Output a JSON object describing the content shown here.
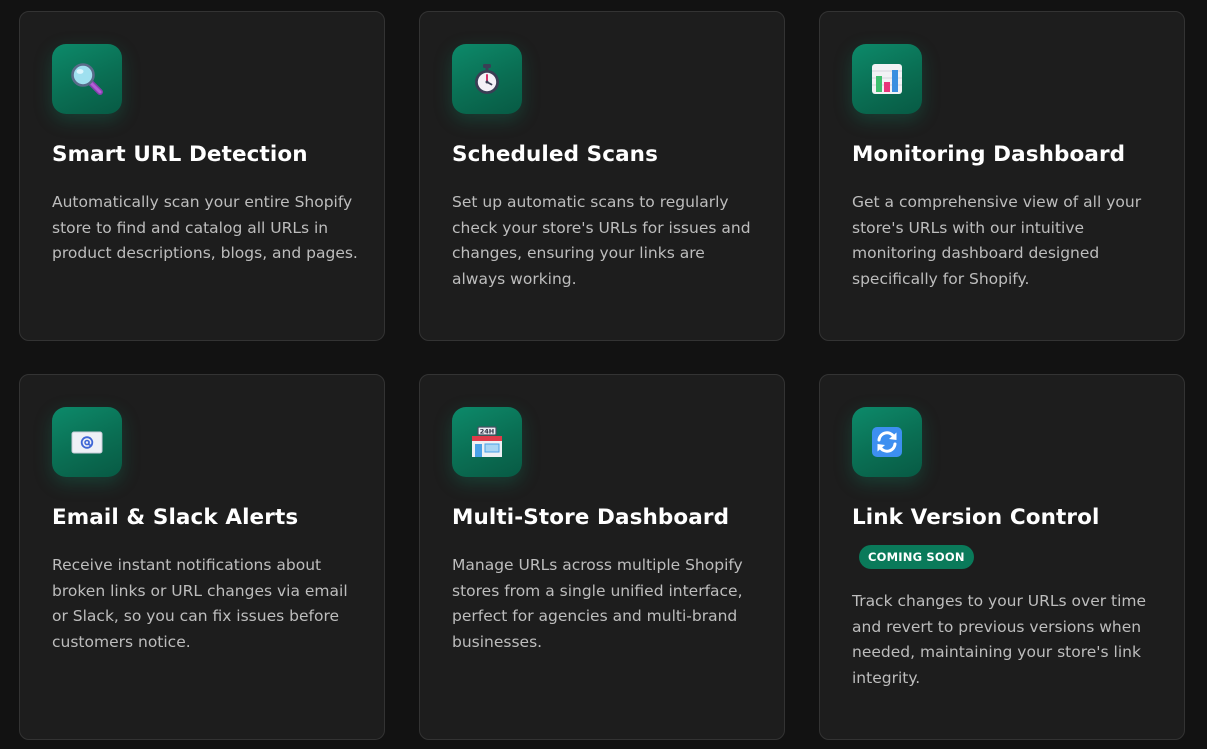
{
  "features": [
    {
      "title": "Smart URL Detection",
      "description": "Automatically scan your entire Shopify store to find and catalog all URLs in product descriptions, blogs, and pages.",
      "icon": "magnifying-glass-icon"
    },
    {
      "title": "Scheduled Scans",
      "description": "Set up automatic scans to regularly check your store's URLs for issues and changes, ensuring your links are always working.",
      "icon": "stopwatch-icon"
    },
    {
      "title": "Monitoring Dashboard",
      "description": "Get a comprehensive view of all your store's URLs with our intuitive monitoring dashboard designed specifically for Shopify.",
      "icon": "bar-chart-icon"
    },
    {
      "title": "Email & Slack Alerts",
      "description": "Receive instant notifications about broken links or URL changes via email or Slack, so you can fix issues before customers notice.",
      "icon": "email-icon"
    },
    {
      "title": "Multi-Store Dashboard",
      "description": "Manage URLs across multiple Shopify stores from a single unified interface, perfect for agencies and multi-brand businesses.",
      "icon": "store-24h-icon"
    },
    {
      "title": "Link Version Control",
      "badge": "COMING SOON",
      "description": "Track changes to your URLs over time and revert to previous versions when needed, maintaining your store's link integrity.",
      "icon": "sync-arrows-icon"
    }
  ],
  "colors": {
    "background": "#121212",
    "card": "#1d1d1d",
    "card_border": "#333333",
    "accent": "#0a7a5a",
    "title": "#ffffff",
    "body_text": "#bdbdbd"
  }
}
